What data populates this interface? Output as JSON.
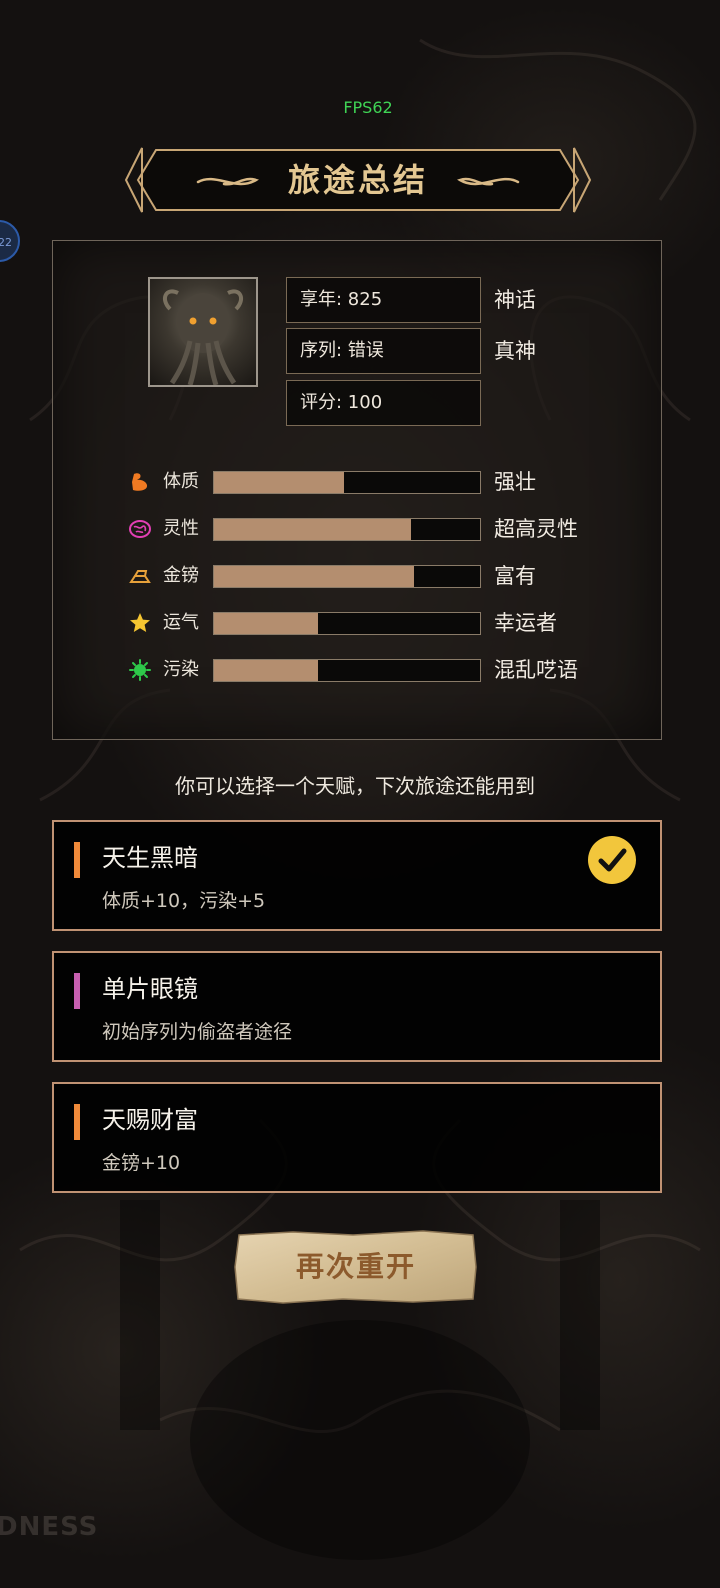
{
  "status": {
    "fps": "FPS62",
    "side_badge": "22"
  },
  "title": "旅途总结",
  "summary": {
    "age_label": "享年: 825",
    "age_rank": "神话",
    "sequence_label": "序列: 错误",
    "sequence_rank": "真神",
    "score_label": "评分: 100"
  },
  "stats": [
    {
      "name": "体质",
      "level": 0.49,
      "desc": "强壮",
      "icon": "flexed-arm-icon",
      "color": "#f07a22"
    },
    {
      "name": "灵性",
      "level": 0.74,
      "desc": "超高灵性",
      "icon": "brain-icon",
      "color": "#e23fb4"
    },
    {
      "name": "金镑",
      "level": 0.75,
      "desc": "富有",
      "icon": "gold-bar-icon",
      "color": "#e7a13a"
    },
    {
      "name": "运气",
      "level": 0.39,
      "desc": "幸运者",
      "icon": "star-icon",
      "color": "#f5c531"
    },
    {
      "name": "污染",
      "level": 0.39,
      "desc": "混乱呓语",
      "icon": "virus-icon",
      "color": "#2ec94a"
    }
  ],
  "prompt": "你可以选择一个天赋，下次旅途还能用到",
  "talents": [
    {
      "name": "天生黑暗",
      "desc": "体质+10，污染+5",
      "accent": "#f08a3a",
      "selected": true
    },
    {
      "name": "单片眼镜",
      "desc": "初始序列为偷盗者途径",
      "accent": "#c75fb0",
      "selected": false
    },
    {
      "name": "天赐财富",
      "desc": "金镑+10",
      "accent": "#f08a3a",
      "selected": false
    }
  ],
  "restart_label": "再次重开",
  "watermark": "DNESS"
}
